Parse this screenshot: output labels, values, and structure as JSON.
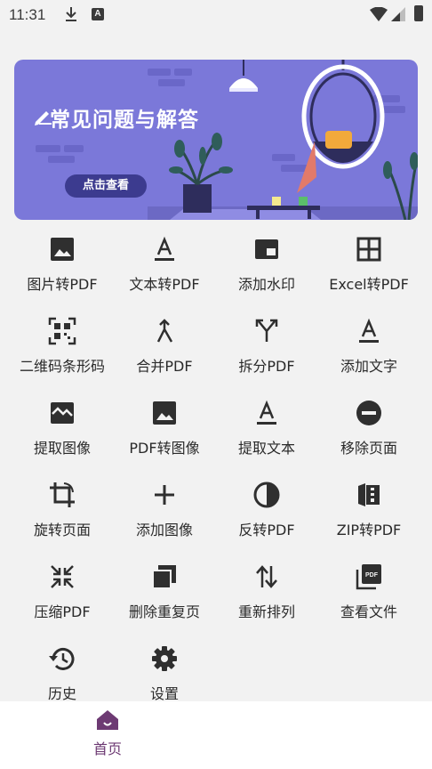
{
  "status_bar": {
    "time": "11:31",
    "notification_icon_letter": "A"
  },
  "banner": {
    "title": "常见问题与解答",
    "button": "点击查看"
  },
  "tools": [
    {
      "label": "图片转PDF",
      "icon": "image-icon"
    },
    {
      "label": "文本转PDF",
      "icon": "text-icon"
    },
    {
      "label": "添加水印",
      "icon": "watermark-icon"
    },
    {
      "label": "Excel转PDF",
      "icon": "table-icon"
    },
    {
      "label": "二维码条形码",
      "icon": "qr-code-icon"
    },
    {
      "label": "合并PDF",
      "icon": "merge-icon"
    },
    {
      "label": "拆分PDF",
      "icon": "split-icon"
    },
    {
      "label": "添加文字",
      "icon": "text-icon"
    },
    {
      "label": "提取图像",
      "icon": "broken-image-icon"
    },
    {
      "label": "PDF转图像",
      "icon": "image-icon"
    },
    {
      "label": "提取文本",
      "icon": "text-icon"
    },
    {
      "label": "移除页面",
      "icon": "remove-circle-icon"
    },
    {
      "label": "旋转页面",
      "icon": "rotate-icon"
    },
    {
      "label": "添加图像",
      "icon": "plus-icon"
    },
    {
      "label": "反转PDF",
      "icon": "contrast-icon"
    },
    {
      "label": "ZIP转PDF",
      "icon": "zip-icon"
    },
    {
      "label": "压缩PDF",
      "icon": "compress-icon"
    },
    {
      "label": "删除重复页",
      "icon": "duplicate-icon"
    },
    {
      "label": "重新排列",
      "icon": "reorder-icon"
    },
    {
      "label": "查看文件",
      "icon": "pdf-file-icon"
    },
    {
      "label": "历史",
      "icon": "history-icon"
    },
    {
      "label": "设置",
      "icon": "gear-icon"
    }
  ],
  "nav": {
    "home": "首页"
  },
  "colors": {
    "banner": "#7b78d9",
    "accent": "#6d3a73",
    "icon": "#2f2f2f"
  }
}
